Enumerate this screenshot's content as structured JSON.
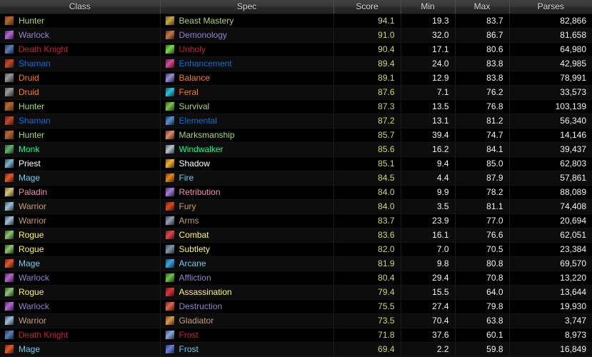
{
  "table": {
    "columns": [
      {
        "key": "class",
        "label": "Class",
        "align": "center"
      },
      {
        "key": "spec",
        "label": "Spec",
        "align": "center"
      },
      {
        "key": "score",
        "label": "Score",
        "align": "center"
      },
      {
        "key": "min",
        "label": "Min",
        "align": "center"
      },
      {
        "key": "max",
        "label": "Max",
        "align": "center"
      },
      {
        "key": "parses",
        "label": "Parses",
        "align": "center"
      }
    ],
    "class_colors": {
      "Hunter": "#abd473",
      "Warlock": "#9482c9",
      "Death Knight": "#c41f3b",
      "Shaman": "#0070de",
      "Druid": "#ff7d0a",
      "Monk": "#00ff96",
      "Priest": "#ffffff",
      "Mage": "#69ccf0",
      "Paladin": "#f58cba",
      "Warrior": "#c79c6e",
      "Rogue": "#fff569"
    },
    "score_color": "#c8d96f",
    "rows": [
      {
        "class": "Hunter",
        "spec": "Beast Mastery",
        "score": "94.1",
        "min": "19.3",
        "max": "83.7",
        "parses": "82,866",
        "class_icon": "hunter-class-icon",
        "spec_icon": "beast-mastery-spec-icon"
      },
      {
        "class": "Warlock",
        "spec": "Demonology",
        "score": "91.0",
        "min": "32.0",
        "max": "86.7",
        "parses": "81,658",
        "class_icon": "warlock-class-icon",
        "spec_icon": "demonology-spec-icon"
      },
      {
        "class": "Death Knight",
        "spec": "Unholy",
        "score": "90.4",
        "min": "17.1",
        "max": "80.6",
        "parses": "64,980",
        "class_icon": "death-knight-class-icon",
        "spec_icon": "unholy-spec-icon"
      },
      {
        "class": "Shaman",
        "spec": "Enhancement",
        "score": "89.4",
        "min": "24.0",
        "max": "83.8",
        "parses": "42,985",
        "class_icon": "shaman-class-icon",
        "spec_icon": "enhancement-spec-icon"
      },
      {
        "class": "Druid",
        "spec": "Balance",
        "score": "89.1",
        "min": "12.9",
        "max": "83.8",
        "parses": "78,991",
        "class_icon": "druid-class-icon",
        "spec_icon": "balance-spec-icon"
      },
      {
        "class": "Druid",
        "spec": "Feral",
        "score": "87.6",
        "min": "7.1",
        "max": "76.2",
        "parses": "33,573",
        "class_icon": "druid-class-icon",
        "spec_icon": "feral-spec-icon"
      },
      {
        "class": "Hunter",
        "spec": "Survival",
        "score": "87.3",
        "min": "13.5",
        "max": "76.8",
        "parses": "103,139",
        "class_icon": "hunter-class-icon",
        "spec_icon": "survival-spec-icon"
      },
      {
        "class": "Shaman",
        "spec": "Elemental",
        "score": "87.2",
        "min": "13.1",
        "max": "81.2",
        "parses": "56,340",
        "class_icon": "shaman-class-icon",
        "spec_icon": "elemental-spec-icon"
      },
      {
        "class": "Hunter",
        "spec": "Marksmanship",
        "score": "85.7",
        "min": "39.4",
        "max": "74.7",
        "parses": "14,146",
        "class_icon": "hunter-class-icon",
        "spec_icon": "marksmanship-spec-icon"
      },
      {
        "class": "Monk",
        "spec": "Windwalker",
        "score": "85.6",
        "min": "16.2",
        "max": "84.1",
        "parses": "39,437",
        "class_icon": "monk-class-icon",
        "spec_icon": "windwalker-spec-icon"
      },
      {
        "class": "Priest",
        "spec": "Shadow",
        "score": "85.1",
        "min": "9.4",
        "max": "85.0",
        "parses": "62,803",
        "class_icon": "priest-class-icon",
        "spec_icon": "shadow-spec-icon"
      },
      {
        "class": "Mage",
        "spec": "Fire",
        "score": "84.5",
        "min": "4.4",
        "max": "87.9",
        "parses": "57,861",
        "class_icon": "mage-class-icon",
        "spec_icon": "fire-spec-icon"
      },
      {
        "class": "Paladin",
        "spec": "Retribution",
        "score": "84.0",
        "min": "9.9",
        "max": "78.2",
        "parses": "88,089",
        "class_icon": "paladin-class-icon",
        "spec_icon": "retribution-spec-icon"
      },
      {
        "class": "Warrior",
        "spec": "Fury",
        "score": "84.0",
        "min": "3.5",
        "max": "81.1",
        "parses": "74,408",
        "class_icon": "warrior-class-icon",
        "spec_icon": "fury-spec-icon"
      },
      {
        "class": "Warrior",
        "spec": "Arms",
        "score": "83.7",
        "min": "23.9",
        "max": "77.0",
        "parses": "20,694",
        "class_icon": "warrior-class-icon",
        "spec_icon": "arms-spec-icon"
      },
      {
        "class": "Rogue",
        "spec": "Combat",
        "score": "83.6",
        "min": "16.1",
        "max": "76.6",
        "parses": "62,051",
        "class_icon": "rogue-class-icon",
        "spec_icon": "combat-spec-icon"
      },
      {
        "class": "Rogue",
        "spec": "Subtlety",
        "score": "82.0",
        "min": "7.0",
        "max": "70.5",
        "parses": "23,384",
        "class_icon": "rogue-class-icon",
        "spec_icon": "subtlety-spec-icon"
      },
      {
        "class": "Mage",
        "spec": "Arcane",
        "score": "81.9",
        "min": "9.8",
        "max": "80.8",
        "parses": "69,570",
        "class_icon": "mage-class-icon",
        "spec_icon": "arcane-spec-icon"
      },
      {
        "class": "Warlock",
        "spec": "Affliction",
        "score": "80.4",
        "min": "29.4",
        "max": "70.8",
        "parses": "13,220",
        "class_icon": "warlock-class-icon",
        "spec_icon": "affliction-spec-icon"
      },
      {
        "class": "Rogue",
        "spec": "Assassination",
        "score": "79.4",
        "min": "15.5",
        "max": "64.0",
        "parses": "13,644",
        "class_icon": "rogue-class-icon",
        "spec_icon": "assassination-spec-icon"
      },
      {
        "class": "Warlock",
        "spec": "Destruction",
        "score": "75.5",
        "min": "27.4",
        "max": "79.8",
        "parses": "19,930",
        "class_icon": "warlock-class-icon",
        "spec_icon": "destruction-spec-icon"
      },
      {
        "class": "Warrior",
        "spec": "Gladiator",
        "score": "73.5",
        "min": "70.4",
        "max": "63.8",
        "parses": "3,747",
        "class_icon": "warrior-class-icon",
        "spec_icon": "gladiator-spec-icon"
      },
      {
        "class": "Death Knight",
        "spec": "Frost",
        "score": "71.8",
        "min": "37.6",
        "max": "60.1",
        "parses": "8,973",
        "class_icon": "death-knight-class-icon",
        "spec_icon": "frost-dk-spec-icon"
      },
      {
        "class": "Mage",
        "spec": "Frost",
        "score": "69.4",
        "min": "2.2",
        "max": "59.8",
        "parses": "16,849",
        "class_icon": "mage-class-icon",
        "spec_icon": "frost-mage-spec-icon"
      }
    ]
  },
  "icon_art": {
    "hunter-class-icon": "linear-gradient(135deg,#6b3a1e 0%,#b5682c 40%,#3a2314 100%)",
    "warlock-class-icon": "linear-gradient(135deg,#3d1b4a 0%,#b06ad0 45%,#2a0f33 100%)",
    "death-knight-class-icon": "linear-gradient(135deg,#1b2a44 0%,#5d7fb5 45%,#10182a 100%)",
    "shaman-class-icon": "linear-gradient(135deg,#5a1f12 0%,#c24a2a 45%,#2e1008 100%)",
    "druid-class-icon": "linear-gradient(135deg,#4a4a4a 0%,#9a9a9a 40%,#1c1c1c 100%)",
    "monk-class-icon": "linear-gradient(135deg,#1f4a2a 0%,#63b06f 45%,#10240f 100%)",
    "priest-class-icon": "linear-gradient(135deg,#22333f 0%,#7fb6c9 45%,#101a1f 100%)",
    "mage-class-icon": "linear-gradient(135deg,#5a1b12 0%,#e05a2a 45%,#2a0c06 100%)",
    "paladin-class-icon": "linear-gradient(135deg,#6a5a26 0%,#d9c37a 45%,#2e2810 100%)",
    "warrior-class-icon": "linear-gradient(135deg,#2a3a4a 0%,#9fc2d9 45%,#151f28 100%)",
    "rogue-class-icon": "linear-gradient(135deg,#24401f 0%,#8fc471 45%,#11210e 100%)",
    "beast-mastery-spec-icon": "linear-gradient(135deg,#6b5520 0%,#c7a846 45%,#2e2410 100%)",
    "demonology-spec-icon": "linear-gradient(135deg,#4a2a1a 0%,#c47a4a 45%,#221208 100%)",
    "unholy-spec-icon": "linear-gradient(135deg,#2a4a1a 0%,#7fd94a 45%,#122208 100%)",
    "enhancement-spec-icon": "linear-gradient(135deg,#4a1a3a 0%,#d94a9a 45%,#220a18 100%)",
    "balance-spec-icon": "linear-gradient(135deg,#2a2244 0%,#9a8fd9 45%,#121024 100%)",
    "feral-spec-icon": "linear-gradient(135deg,#103a4a 0%,#2fc4e0 45%,#081c24 100%)",
    "survival-spec-icon": "linear-gradient(135deg,#2a4a1a 0%,#7fc44a 45%,#122208 100%)",
    "elemental-spec-icon": "linear-gradient(135deg,#16243f 0%,#5a8fd9 45%,#0a1020 100%)",
    "marksmanship-spec-icon": "linear-gradient(135deg,#5a2a20 0%,#d98f6a 45%,#2a1208 100%)",
    "windwalker-spec-icon": "linear-gradient(135deg,#3a4450 0%,#b9c6d2 45%,#1a2028 100%)",
    "shadow-spec-icon": "linear-gradient(135deg,#6b4a10 0%,#f0b038 45%,#2e2008 100%)",
    "fire-spec-icon": "linear-gradient(135deg,#5a2a08 0%,#e08a20 45%,#2a1204 100%)",
    "retribution-spec-icon": "linear-gradient(135deg,#3a2450 0%,#a87fd9 45%,#1a1028 100%)",
    "fury-spec-icon": "linear-gradient(135deg,#5a1408 0%,#d94a20 45%,#2a0a04 100%)",
    "arms-spec-icon": "linear-gradient(135deg,#2a3040 0%,#8f9fb5 45%,#141820 100%)",
    "combat-spec-icon": "linear-gradient(135deg,#5a1418 0%,#d9484f 45%,#2a0a0c 100%)",
    "subtlety-spec-icon": "linear-gradient(135deg,#2a3a48 0%,#7f9aab 45%,#141c22 100%)",
    "arcane-spec-icon": "linear-gradient(135deg,#123a5a 0%,#3aa8e0 45%,#081c2a 100%)",
    "affliction-spec-icon": "linear-gradient(135deg,#1e4420 0%,#6fc44a 45%,#0e2010 100%)",
    "assassination-spec-icon": "linear-gradient(135deg,#5a1010 0%,#d9383a 45%,#2a0808 100%)",
    "destruction-spec-icon": "linear-gradient(135deg,#5a1a10 0%,#e0664a 45%,#2a0c06 100%)",
    "gladiator-spec-icon": "linear-gradient(135deg,#5a3a18 0%,#d99a4a 45%,#2a1a08 100%)",
    "frost-dk-spec-icon": "linear-gradient(135deg,#2a3a5a 0%,#8fa8d9 45%,#141c2a 100%)",
    "frost-mage-spec-icon": "linear-gradient(135deg,#1e2a5a 0%,#6a7fd9 45%,#0e1428 100%)"
  }
}
